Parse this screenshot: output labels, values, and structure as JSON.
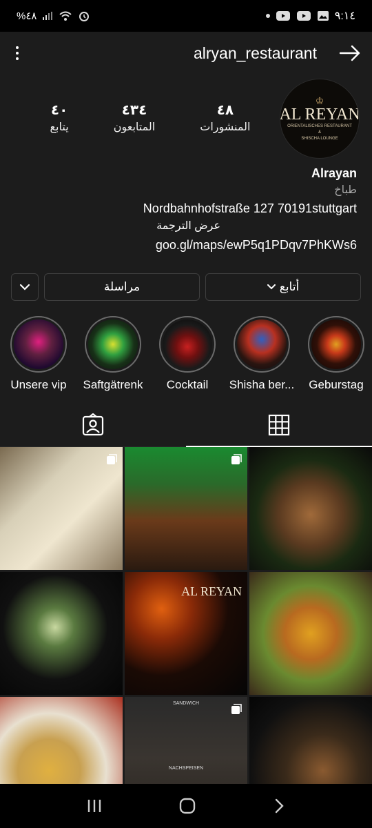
{
  "status_bar": {
    "left_text": "%٤٨",
    "time": "٩:١٤"
  },
  "header": {
    "username": "alryan_restaurant"
  },
  "stats": [
    {
      "value": "٤٨",
      "label": "المنشورات"
    },
    {
      "value": "٤٣٤",
      "label": "المتابعون"
    },
    {
      "value": "٤٠",
      "label": "يتابع"
    }
  ],
  "avatar": {
    "title": "AL REYAN",
    "subtitle_line1": "ORIENTALISCHES RESTAURANT",
    "subtitle_line2": "&",
    "subtitle_line3": "SHISCHA LOUNGE"
  },
  "bio": {
    "name": "Alrayan",
    "category": "طباخ",
    "address": "Nordbahnhofstraße 127   70191stuttgart",
    "translate": "عرض الترجمة",
    "link": "goo.gl/maps/ewP5q1PDqv7PhKWs6"
  },
  "actions": {
    "follow_label": "أتابع",
    "message_label": "مراسلة"
  },
  "highlights": [
    {
      "label": "Geburstag",
      "color_a": "#1a0a0a",
      "color_b": "#c83a1a"
    },
    {
      "label": "Shisha ber...",
      "color_a": "#0a1530",
      "color_b": "#b83020"
    },
    {
      "label": "Cocktail",
      "color_a": "#0a0a0a",
      "color_b": "#a01818"
    },
    {
      "label": "Saftgätrenk",
      "color_a": "#102010",
      "color_b": "#d8e030"
    },
    {
      "label": "Unsere vip",
      "color_a": "#200a30",
      "color_b": "#e02080"
    }
  ],
  "grid": [
    {
      "name": "post-hummus",
      "bg": "linear-gradient(135deg,#7a6a50 0%,#d8d0b8 35%,#efe6cf 60%,#8b7a60 100%)",
      "multi": true
    },
    {
      "name": "post-interior",
      "bg": "linear-gradient(180deg,#1a8a30 0%,#2a6a2a 30%,#6a3a1a 60%,#2a1a10 100%)",
      "multi": true
    },
    {
      "name": "post-kebab-plate",
      "bg": "radial-gradient(circle at 50% 55%,#a06a3a 0%,#5a3a20 35%,#1a2a12 60%,#0a0a0a 100%)",
      "multi": false
    },
    {
      "name": "post-cocktail",
      "bg": "radial-gradient(circle at 45% 45%,#c8d8a0 0%,#5a7a40 20%,#101010 55%,#050505 100%)",
      "multi": false
    },
    {
      "name": "post-logo-grill",
      "bg": "radial-gradient(circle at 30% 30%,#e06010 0%,#8a2a08 25%,#1a0a05 55%,#050505 100%)",
      "multi": false
    },
    {
      "name": "post-rice-dish",
      "bg": "radial-gradient(circle at 50% 50%,#e0a020 0%,#b86a20 30%,#6a8a30 55%,#3a2a1a 100%)",
      "multi": false
    },
    {
      "name": "post-rice-plate",
      "bg": "radial-gradient(circle at 40% 60%,#e0b040 0%,#c8a050 30%,#e8e0d0 55%,#aa3020 100%)",
      "multi": false
    },
    {
      "name": "post-menu",
      "bg": "linear-gradient(180deg,#2a2a2a 0%,#3a3530 50%,#2a2520 100%)",
      "multi": true
    },
    {
      "name": "post-dark-food",
      "bg": "radial-gradient(circle at 60% 60%,#8a5a30 0%,#3a2a1a 35%,#101010 70%,#050505 100%)",
      "multi": false
    }
  ],
  "grid_overlays": {
    "logo_text": "AL REYAN",
    "menu_heading": "SANDWICH",
    "menu_footer": "NACHSPEISEN"
  }
}
